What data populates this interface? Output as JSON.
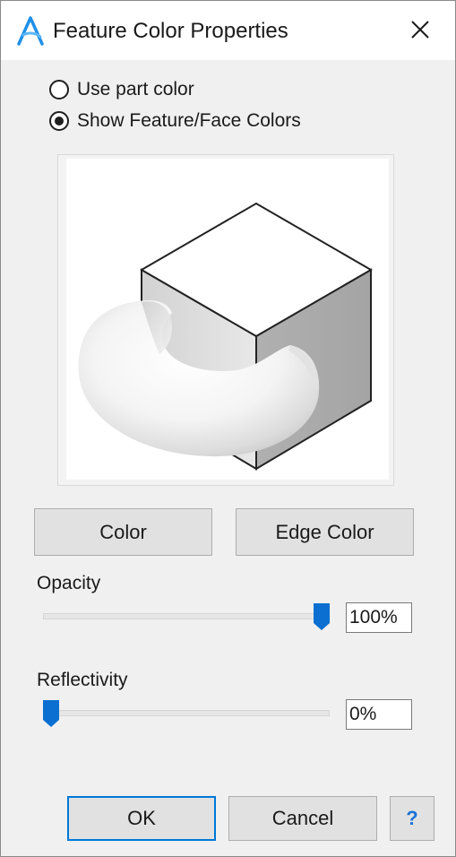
{
  "window": {
    "title": "Feature Color Properties",
    "logo_icon": "app-a-logo-icon",
    "close_icon": "close-icon"
  },
  "options": {
    "use_part_color": {
      "label": "Use part color",
      "checked": false
    },
    "show_feature_colors": {
      "label": "Show Feature/Face Colors",
      "checked": true
    }
  },
  "preview": {
    "content": "cube-and-torus-preview"
  },
  "buttons": {
    "color": "Color",
    "edge_color": "Edge Color",
    "ok": "OK",
    "cancel": "Cancel",
    "help": "?"
  },
  "opacity": {
    "label": "Opacity",
    "value_text": "100%",
    "level": 1.0
  },
  "reflectivity": {
    "label": "Reflectivity",
    "value_text": "0%",
    "level": 0.0
  },
  "colors": {
    "accent": "#0078d7",
    "slider_thumb": "#0a6fd0",
    "help_text": "#1a73d9"
  }
}
